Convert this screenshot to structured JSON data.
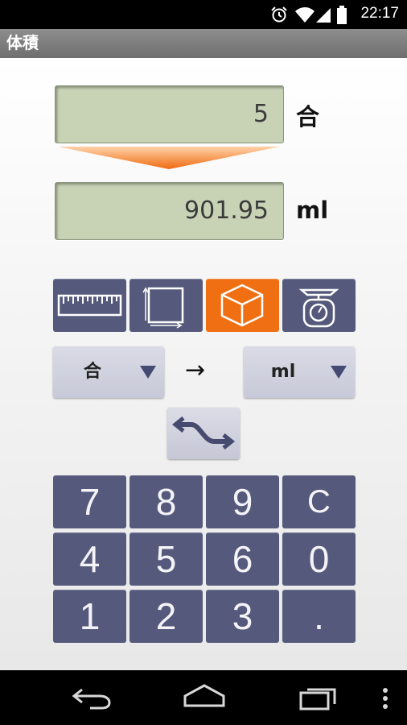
{
  "status_bar": {
    "time": "22:17"
  },
  "title": "体積",
  "input": {
    "value": "5",
    "unit": "合"
  },
  "output": {
    "value": "901.95",
    "unit": "ml"
  },
  "categories": [
    {
      "name": "length",
      "icon": "ruler-icon",
      "active": false
    },
    {
      "name": "area",
      "icon": "square-icon",
      "active": false
    },
    {
      "name": "volume",
      "icon": "cube-icon",
      "active": true
    },
    {
      "name": "weight",
      "icon": "scale-icon",
      "active": false
    }
  ],
  "from_unit": "合",
  "to_unit": "ml",
  "conversion_arrow": "→",
  "keypad": {
    "k7": "7",
    "k8": "8",
    "k9": "9",
    "clear": "C",
    "k4": "4",
    "k5": "5",
    "k6": "6",
    "k0": "0",
    "k1": "1",
    "k2": "2",
    "k3": "3",
    "dot": "."
  },
  "colors": {
    "key": "#555a7c",
    "accent": "#f06f12",
    "lcd": "#c8d3b6"
  }
}
